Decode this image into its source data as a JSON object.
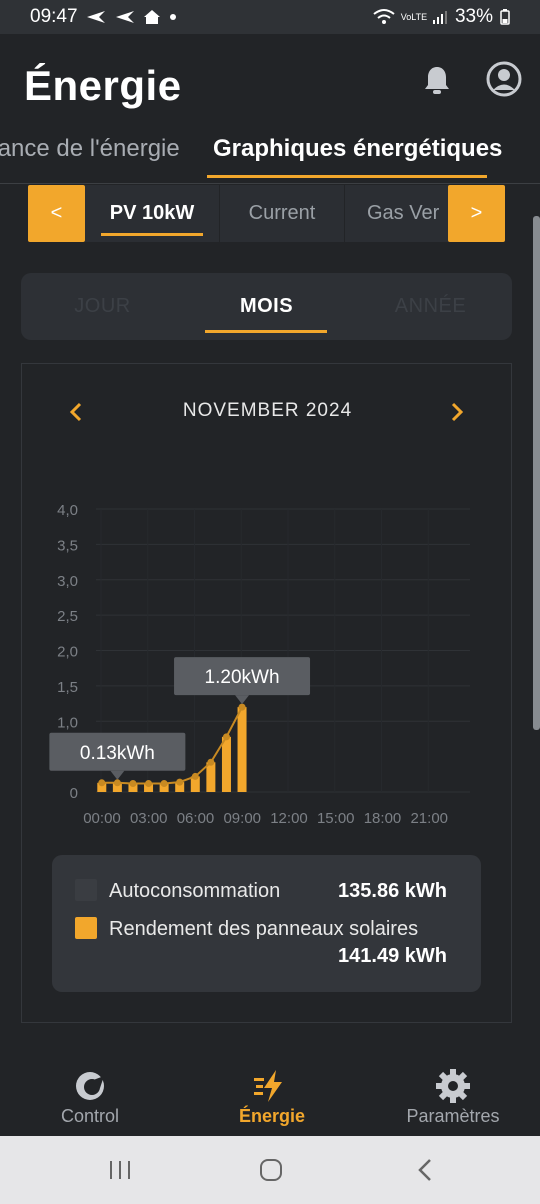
{
  "status_bar": {
    "time": "09:47",
    "battery": "33%",
    "left_icons": [
      "send-icon",
      "send-icon",
      "home-icon",
      "dot-icon"
    ],
    "right_icons": [
      "wifi-icon",
      "volte-icon",
      "signal-icon",
      "battery-icon"
    ],
    "volte_label": "VoLTE"
  },
  "header": {
    "title": "Énergie",
    "icons": [
      "bell-icon",
      "account-icon"
    ]
  },
  "tabs": [
    {
      "label": "Puissance de l'énergie",
      "active": false
    },
    {
      "label": "Graphiques énergétiques",
      "active": true
    }
  ],
  "devices": {
    "prev_label": "<",
    "next_label": ">",
    "items": [
      {
        "label": "PV 10kW",
        "active": true
      },
      {
        "label": "Current",
        "active": false
      },
      {
        "label": "Gas Ver",
        "active": false
      }
    ]
  },
  "period_tabs": [
    {
      "label": "JOUR",
      "active": false
    },
    {
      "label": "MOIS",
      "active": true
    },
    {
      "label": "ANNÉE",
      "active": false
    }
  ],
  "month_nav": {
    "label": "NOVEMBER 2024",
    "prev_icon": "chevron-left-icon",
    "next_icon": "chevron-right-icon"
  },
  "chart_data": {
    "type": "bar",
    "y_ticks": [
      "4,0",
      "3,5",
      "3,0",
      "2,5",
      "2,0",
      "1,5",
      "1,0",
      "0"
    ],
    "y_tick_values": [
      4.0,
      3.5,
      3.0,
      2.5,
      2.0,
      1.5,
      1.0,
      0
    ],
    "ylim": [
      0,
      4.0
    ],
    "x_ticks": [
      "00:00",
      "03:00",
      "06:00",
      "09:00",
      "12:00",
      "15:00",
      "18:00",
      "21:00"
    ],
    "x_range_hours": [
      0,
      24
    ],
    "bar_hours": [
      0,
      1,
      2,
      3,
      4,
      5,
      6,
      7,
      8,
      9
    ],
    "values": [
      0.13,
      0.13,
      0.12,
      0.12,
      0.12,
      0.14,
      0.22,
      0.42,
      0.78,
      1.2
    ],
    "series_color": "#f2a72c",
    "tooltips": [
      {
        "label": "0.13kWh",
        "hour": 1,
        "value": 0.13
      },
      {
        "label": "1.20kWh",
        "hour": 9,
        "value": 1.2
      }
    ],
    "grid": true
  },
  "legend": {
    "items": [
      {
        "label": "Autoconsommation",
        "value": "135.86 kWh",
        "color": "#3a3d42"
      },
      {
        "label": "Rendement des panneaux solaires",
        "value": "141.49 kWh",
        "color": "#f2a72c"
      }
    ]
  },
  "bottom_nav": [
    {
      "label": "Control",
      "icon": "control-icon",
      "active": false
    },
    {
      "label": "Énergie",
      "icon": "energy-bolt-icon",
      "active": true
    },
    {
      "label": "Paramètres",
      "icon": "gear-icon",
      "active": false
    }
  ],
  "system_nav": [
    "recents-icon",
    "home-button-icon",
    "back-icon"
  ]
}
